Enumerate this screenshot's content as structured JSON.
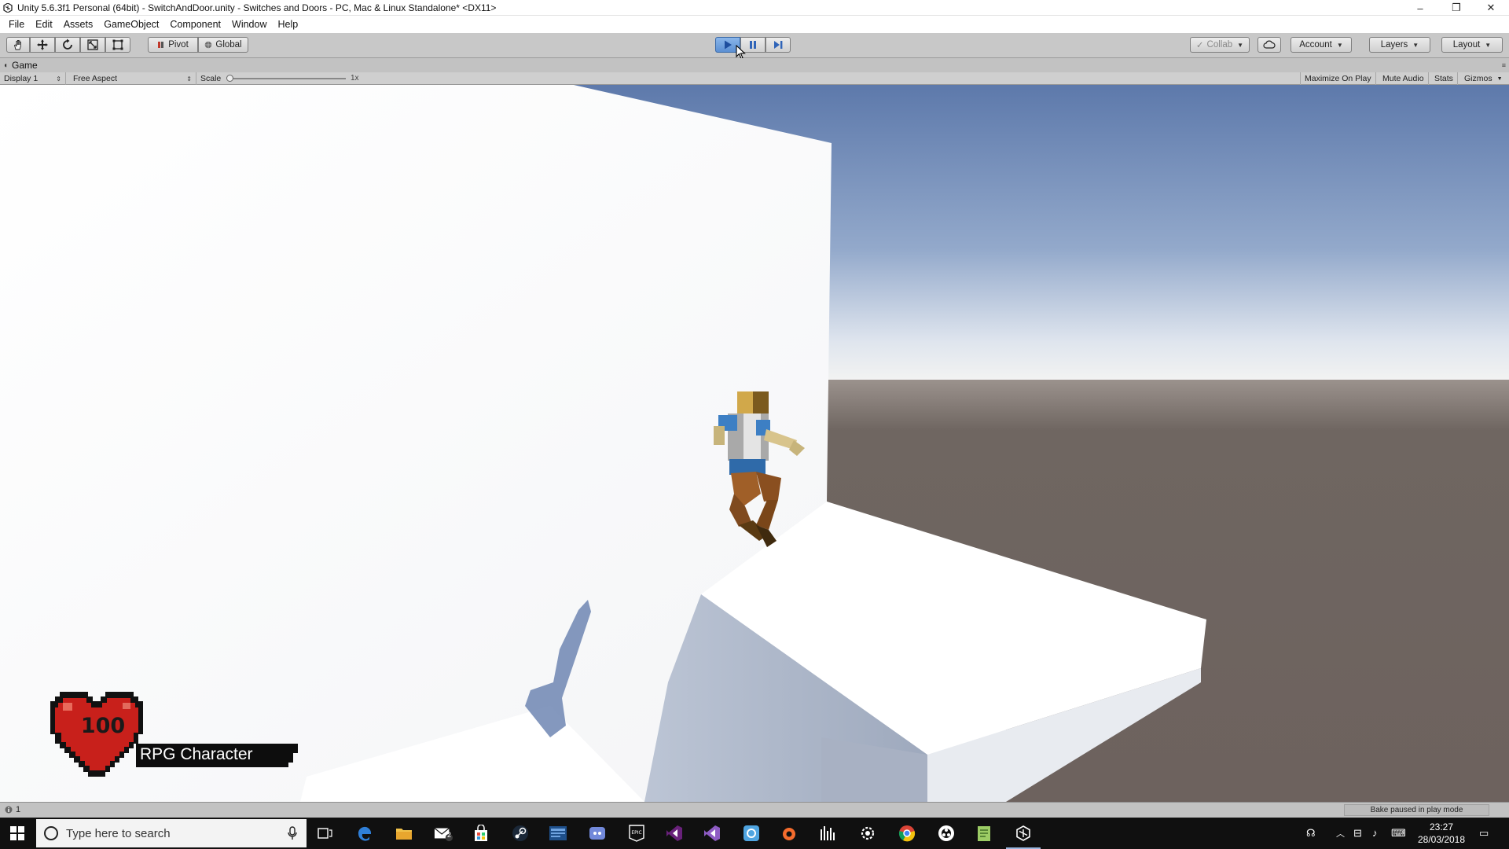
{
  "window": {
    "title": "Unity 5.6.3f1 Personal (64bit) - SwitchAndDoor.unity - Switches and Doors - PC, Mac & Linux Standalone* <DX11>",
    "controls": {
      "minimize": "–",
      "restore": "❐",
      "close": "✕"
    }
  },
  "menu": [
    "File",
    "Edit",
    "Assets",
    "GameObject",
    "Component",
    "Window",
    "Help"
  ],
  "toolbar": {
    "tools": [
      "hand-tool-icon",
      "move-tool-icon",
      "rotate-tool-icon",
      "scale-tool-icon",
      "rect-tool-icon"
    ],
    "pivot_label": "Pivot",
    "global_label": "Global",
    "play_state": "playing",
    "collab_label": "Collab",
    "account_label": "Account",
    "layers_label": "Layers",
    "layout_label": "Layout"
  },
  "game_tab": {
    "label": "Game"
  },
  "game_toolbar": {
    "display": "Display 1",
    "aspect": "Free Aspect",
    "scale_label": "Scale",
    "scale_value": "1x",
    "scale_slider_level": 0.0,
    "maximize_on_play": "Maximize On Play",
    "mute_audio": "Mute Audio",
    "stats": "Stats",
    "gizmos": "Gizmos"
  },
  "hud": {
    "health": "100",
    "character_name": "RPG Character"
  },
  "status": {
    "console_count": "1",
    "bake_status": "Bake paused in play mode"
  },
  "taskbar": {
    "search_placeholder": "Type here to search",
    "pinned": [
      "task-view-icon",
      "edge-icon",
      "file-explorer-icon",
      "mail-icon",
      "store-icon",
      "steam-icon",
      "app-icon",
      "discord-icon",
      "epic-games-icon",
      "visual-studio-icon",
      "visual-studio-alt-icon",
      "uplay-icon",
      "origin-icon",
      "audio-app-icon",
      "steam-settings-icon",
      "chrome-icon",
      "obs-icon",
      "notepad-icon",
      "unity-icon"
    ],
    "time": "23:27",
    "date": "28/03/2018",
    "mail_badge": "2"
  },
  "colors": {
    "play_active": "#5b8fd3",
    "toolbar_bg": "#c8c8c8",
    "sky_top": "#6783b3",
    "ground": "#6f6560",
    "heart_red": "#c8201b",
    "taskbar": "#101010"
  }
}
